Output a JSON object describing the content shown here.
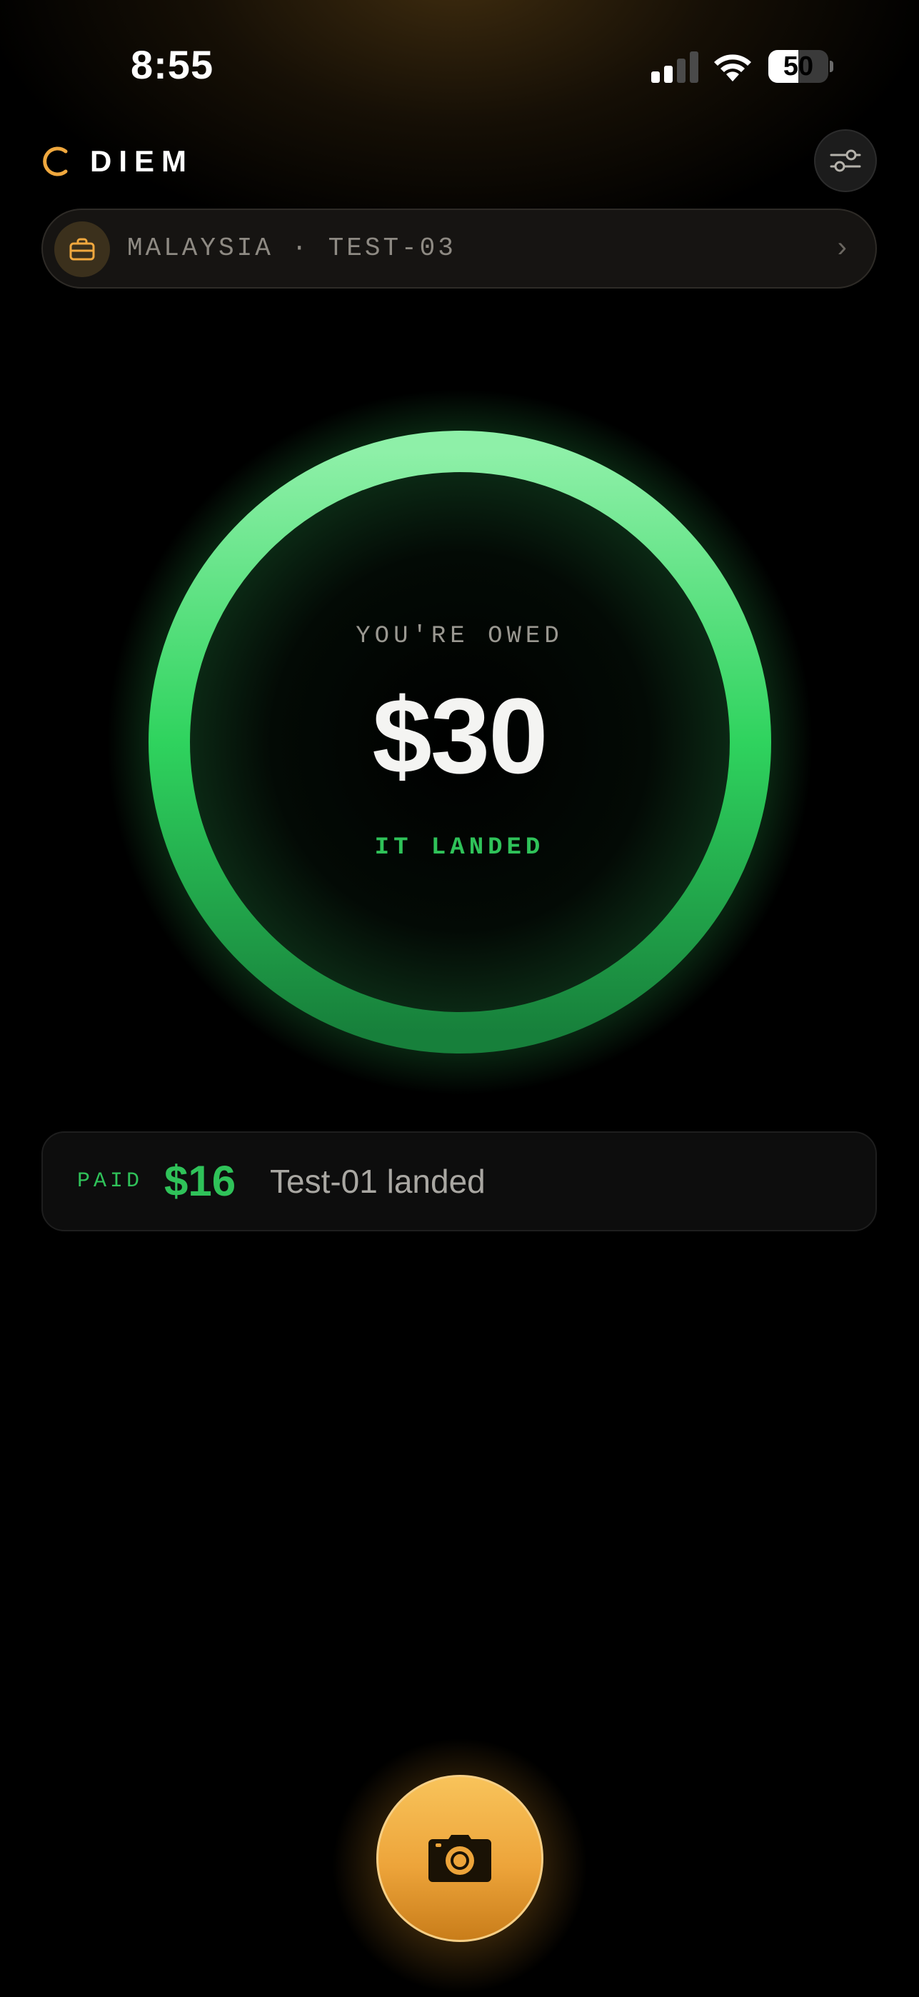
{
  "status_bar": {
    "time": "8:55",
    "battery": "50",
    "battery_level_percent": 50,
    "signal_bars_active": 2,
    "signal_bars_total": 4
  },
  "header": {
    "brand": "DIEM",
    "filter_icon": "sliders-icon"
  },
  "trip_selector": {
    "label": "MALAYSIA · TEST-03",
    "chevron": "›",
    "icon": "briefcase-icon"
  },
  "balance": {
    "label": "YOU'RE OWED",
    "amount": "$30",
    "status": "IT LANDED"
  },
  "paid_card": {
    "label": "PAID",
    "amount": "$16",
    "description": "Test-01 landed"
  },
  "camera_button": {
    "icon": "camera-icon"
  },
  "colors": {
    "accent_green": "#2fc259",
    "accent_gold": "#eda43a",
    "background": "#000000"
  }
}
